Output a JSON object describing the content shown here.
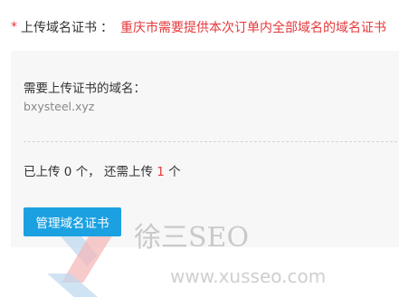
{
  "header": {
    "required_mark": "*",
    "label": "上传域名证书",
    "colon": "：",
    "hint": "重庆市需要提供本次订单内全部域名的域名证书"
  },
  "panel": {
    "subtitle": "需要上传证书的域名：",
    "domain": "bxysteel.xyz",
    "count": {
      "prefix": "已上传",
      "uploaded": "0",
      "unit1": "个，",
      "middle": "还需上传",
      "remaining": "1",
      "unit2": "个"
    },
    "button_label": "管理域名证书"
  },
  "watermark": {
    "brand": "徐三SEO",
    "url": "www.xusseo.com"
  },
  "colors": {
    "accent_red": "#e4393c",
    "button_blue": "#1ba1e2",
    "panel_bg": "#f7f7f7"
  }
}
